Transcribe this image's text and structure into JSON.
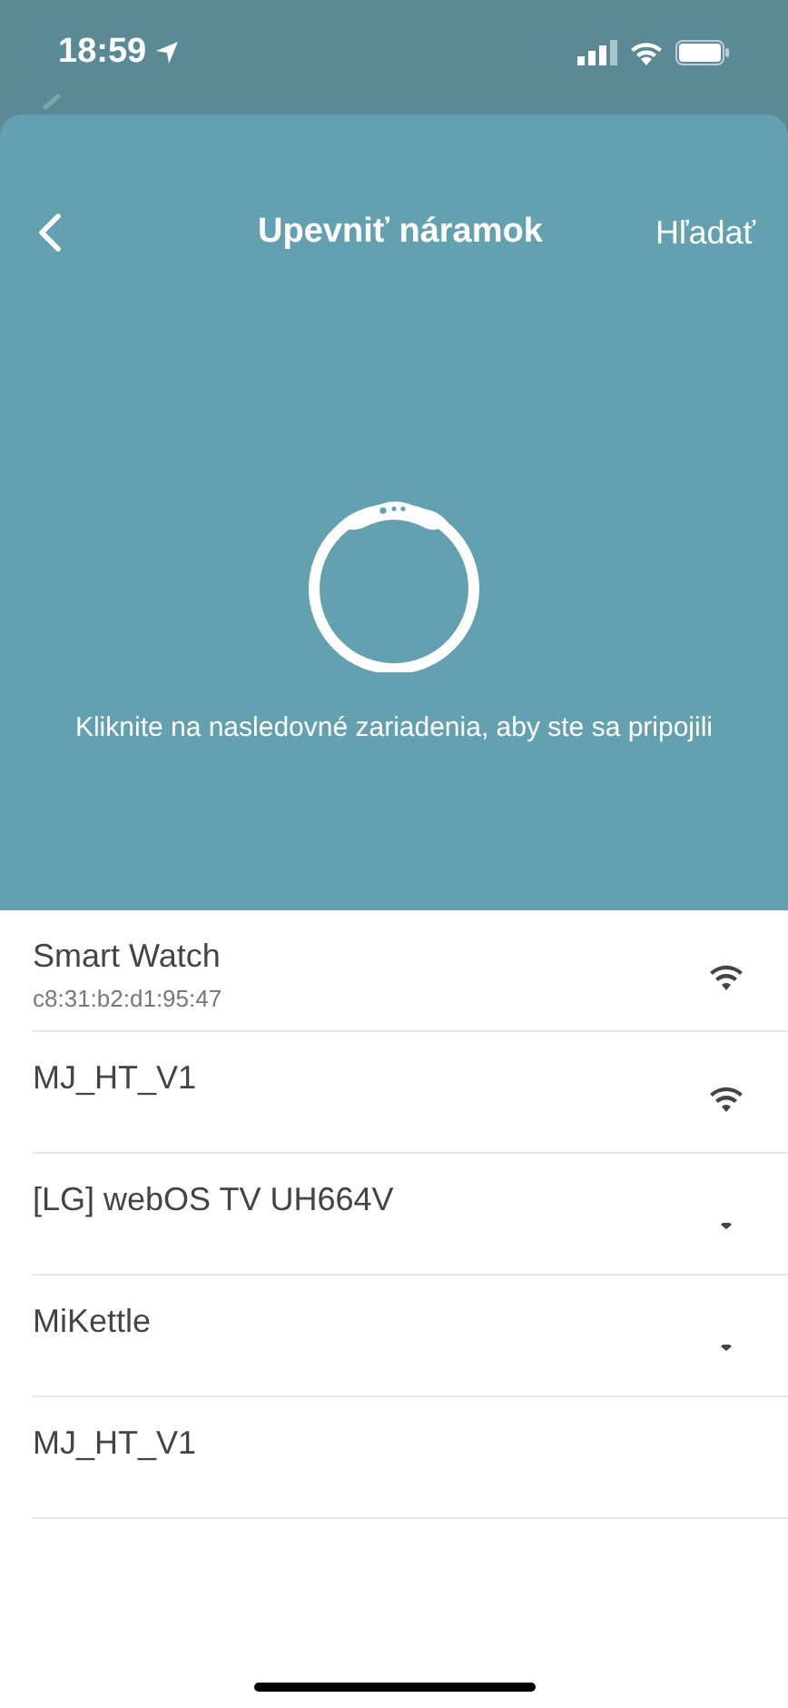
{
  "status_bar": {
    "time": "18:59"
  },
  "sheet": {
    "title": "Upevniť náramok",
    "action": "Hľadať",
    "instruction": "Kliknite na nasledovné zariadenia, aby ste sa pripojili"
  },
  "devices": [
    {
      "name": "Smart Watch",
      "address": "c8:31:b2:d1:95:47",
      "kind": "strong"
    },
    {
      "name": "MJ_HT_V1",
      "kind": "strong"
    },
    {
      "name": "[LG] webOS TV UH664V",
      "kind": "weak"
    },
    {
      "name": "MiKettle",
      "kind": "weak"
    },
    {
      "name": "MJ_HT_V1",
      "kind": "none"
    }
  ]
}
